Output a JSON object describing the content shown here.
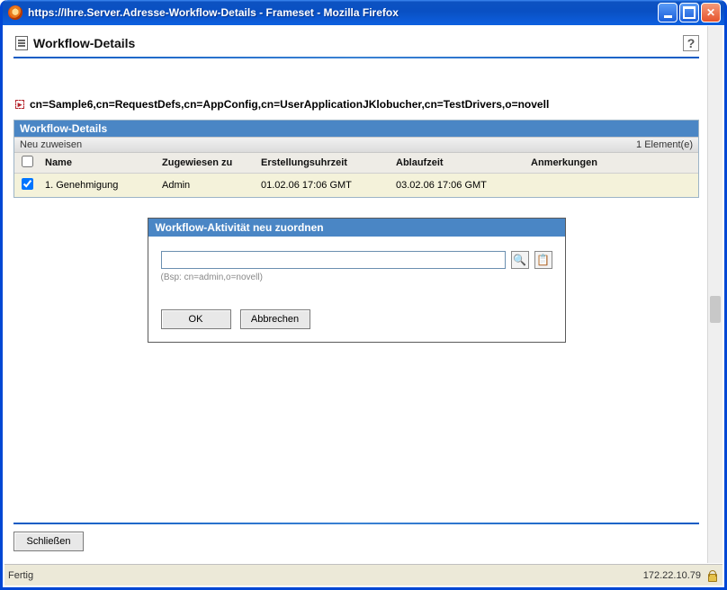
{
  "window": {
    "title": "https://Ihre.Server.Adresse-Workflow-Details - Frameset - Mozilla Firefox"
  },
  "page": {
    "heading": "Workflow-Details"
  },
  "dn": "cn=Sample6,cn=RequestDefs,cn=AppConfig,cn=UserApplicationJKlobucher,cn=TestDrivers,o=novell",
  "panel": {
    "title": "Workflow-Details",
    "action": "Neu zuweisen",
    "count_label": "1 Element(e)",
    "columns": {
      "name": "Name",
      "assigned_to": "Zugewiesen zu",
      "created": "Erstellungsuhrzeit",
      "expires": "Ablaufzeit",
      "comments": "Anmerkungen"
    },
    "rows": [
      {
        "checked": true,
        "name": "1. Genehmigung",
        "assigned_to": "Admin",
        "created": "01.02.06 17:06 GMT",
        "expires": "03.02.06 17:06 GMT",
        "comments": ""
      }
    ]
  },
  "dialog": {
    "title": "Workflow-Aktivität neu zuordnen",
    "input_value": "",
    "hint": "(Bsp: cn=admin,o=novell)",
    "ok": "OK",
    "cancel": "Abbrechen"
  },
  "close_button": "Schließen",
  "status": {
    "left": "Fertig",
    "right": "172.22.10.79"
  },
  "help": "?"
}
